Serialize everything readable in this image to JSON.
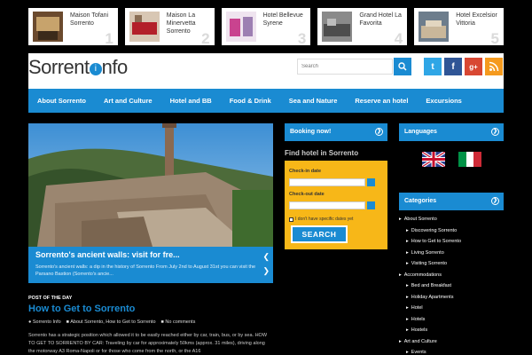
{
  "hotels": [
    {
      "name": "Maison Tofani Sorrento",
      "number": "1"
    },
    {
      "name": "Maison La Minervetta Sorrento",
      "number": "2"
    },
    {
      "name": "Hotel Bellevue Syrene",
      "number": "3"
    },
    {
      "name": "Grand Hotel La Favorita",
      "number": "4"
    },
    {
      "name": "Hotel Excelsior Vittoria",
      "number": "5"
    }
  ],
  "header": {
    "logo_left": "Sorrent",
    "logo_dot": "i",
    "logo_right": "nfo",
    "search_placeholder": "Search"
  },
  "social": {
    "twitter": "t",
    "facebook": "f",
    "google": "g+",
    "rss": "rss"
  },
  "nav": [
    "About Sorrento",
    "Art and Culture",
    "Hotel and BB",
    "Food & Drink",
    "Sea and Nature",
    "Reserve an hotel",
    "Excursions"
  ],
  "slider": {
    "title": "Sorrento's ancient walls: visit for fre...",
    "text": "Sorrento's ancient walls: a dip in the history of Sorrento From July 2nd to August 31st you can visit the Parsano Bastion (Sorrento's ancie..."
  },
  "post": {
    "kicker": "POST OF THE DAY",
    "title": "How to Get to Sorrento",
    "meta": [
      "Sorrento Info",
      "About Sorrento, How to Get to Sorrento",
      "No comments"
    ],
    "body": "Sorrento has a strategic position which allowed it to be easily reached either by car, train, bus, or by sea. HOW TO GET TO SORRENTO BY CAR: Traveling by car for approximately 50kms (approx. 31 miles), driving along the motorway A3 Roma-Napoli or for those who come from the north, or the A16"
  },
  "booking": {
    "heading": "Booking now!",
    "find_hotel": "Find hotel in Sorrento",
    "checkin_label": "Check-in date",
    "checkout_label": "Check-out date",
    "no_dates_label": "I don't have specific dates yet",
    "search_button": "SEARCH"
  },
  "languages": {
    "heading": "Languages"
  },
  "categories": {
    "heading": "Categories",
    "items": [
      {
        "label": "About Sorrento",
        "sub": false
      },
      {
        "label": "Discovering Sorrento",
        "sub": true
      },
      {
        "label": "How to Get to Sorrento",
        "sub": true
      },
      {
        "label": "Living Sorrento",
        "sub": true
      },
      {
        "label": "Visiting Sorrento",
        "sub": true
      },
      {
        "label": "Accommodations",
        "sub": false
      },
      {
        "label": "Bed and Breakfast",
        "sub": true
      },
      {
        "label": "Holiday Apartments",
        "sub": true
      },
      {
        "label": "Hotel",
        "sub": true
      },
      {
        "label": "Hotels",
        "sub": true
      },
      {
        "label": "Hostels",
        "sub": true
      },
      {
        "label": "Art and Culture",
        "sub": false
      },
      {
        "label": "Events",
        "sub": true
      }
    ]
  },
  "colors": {
    "accent": "#1a8bd2",
    "booking_bg": "#f7b718",
    "page_bg": "#000000"
  }
}
